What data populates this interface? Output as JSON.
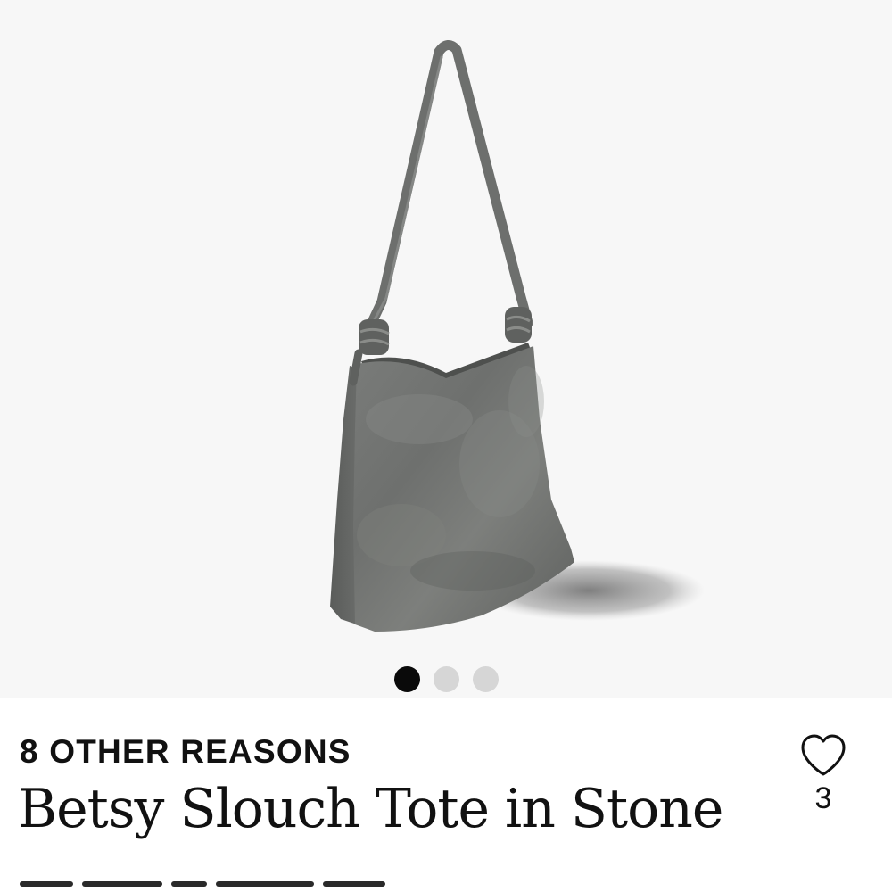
{
  "product": {
    "brand": "8 OTHER REASONS",
    "name": "Betsy Slouch Tote in Stone",
    "image": {
      "subject": "bag-photo",
      "background_color": "#f7f7f7",
      "bag_color": "#6f716f"
    },
    "gallery": {
      "image_count": 3,
      "active_index": 0
    },
    "likes": {
      "icon": "heart-outline-icon",
      "count": "3"
    }
  },
  "colors": {
    "text": "#111111",
    "dot_active": "#0a0a0a",
    "dot_inactive": "#d6d6d6"
  }
}
